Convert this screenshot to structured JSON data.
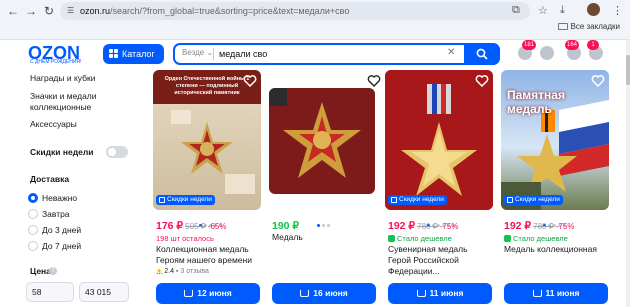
{
  "browser": {
    "url_host": "ozon.ru",
    "url_rest": "/search/?from_global=true&sorting=price&text=медали+сво",
    "bookmarks_label": "Все закладки"
  },
  "header": {
    "logo": "OZON",
    "logo_sub": "С ДНЁМ РОЖДЕНИЯ!",
    "catalog_label": "Каталог",
    "search_scope": "Везде",
    "search_value": "медали сво",
    "badge_1": "181",
    "badge_2": "164",
    "badge_3": "1"
  },
  "sidebar": {
    "items": [
      "Награды и кубки",
      "Значки и медали коллекционные",
      "Аксессуары"
    ],
    "week_discount_label": "Скидки недели",
    "delivery_heading": "Доставка",
    "delivery_options": [
      "Неважно",
      "Завтра",
      "До 3 дней",
      "До 7 дней"
    ],
    "price_heading": "Цена",
    "price_from": "58",
    "price_to": "43 015"
  },
  "products": [
    {
      "image_caption": "Орден Отечественной войны 1 степени — подлинный исторический памятник",
      "tag": "Скидки недели",
      "price": "176 ₽",
      "old_price": "505 ₽",
      "discount": "-65%",
      "sub": "198 шт осталось",
      "title": "Коллекционная медаль Героям нашего времени ...",
      "rating": "2.4",
      "reviews": "3 отзыва",
      "button": "12 июня"
    },
    {
      "tag": "",
      "price": "190 ₽",
      "title": "Медаль",
      "button": "16 июня"
    },
    {
      "tag": "Скидки недели",
      "price": "192 ₽",
      "old_price": "780 ₽",
      "discount": "-75%",
      "sub": "Стало дешевле",
      "title": "Сувенирная медаль Герой Российской Федерации...",
      "button": "11 июня"
    },
    {
      "image_caption": "Памятная медаль",
      "tag": "Скидки недели",
      "price": "192 ₽",
      "old_price": "780 ₽",
      "discount": "-75%",
      "sub": "Стало дешевле",
      "title": "Медаль коллекционная",
      "button": "11 июня"
    }
  ],
  "colors": {
    "brand": "#005bff",
    "price_red": "#f91155",
    "price_green": "#10c44c"
  }
}
